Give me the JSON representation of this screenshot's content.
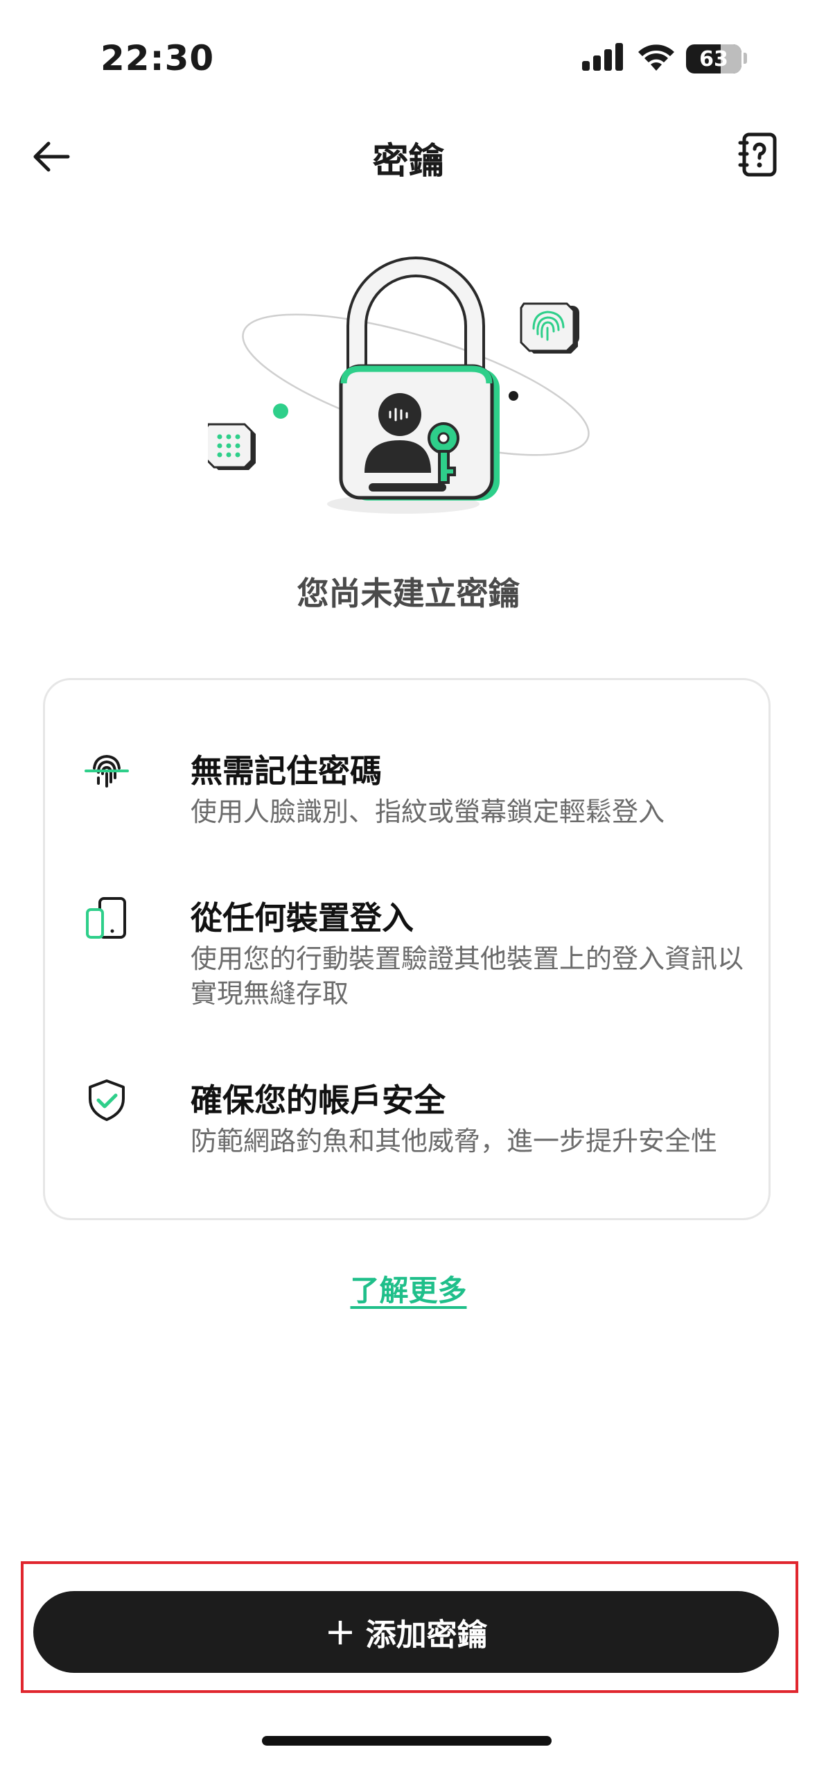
{
  "status_bar": {
    "time": "22:30",
    "battery": "63",
    "icons": [
      "signal-icon",
      "wifi-icon",
      "battery-icon"
    ]
  },
  "nav": {
    "title": "密鑰",
    "back_icon": "arrow-left-icon",
    "help_icon": "help-book-icon"
  },
  "hero": {
    "illustration": "padlock-with-user-and-key",
    "accent_color": "#2ecf8a"
  },
  "empty_state": {
    "title": "您尚未建立密鑰"
  },
  "features": [
    {
      "icon": "fingerprint-icon",
      "title": "無需記住密碼",
      "description": "使用人臉識別、指紋或螢幕鎖定輕鬆登入"
    },
    {
      "icon": "devices-icon",
      "title": "從任何裝置登入",
      "description": "使用您的行動裝置驗證其他裝置上的登入資訊以實現無縫存取"
    },
    {
      "icon": "shield-check-icon",
      "title": "確保您的帳戶安全",
      "description": "防範網路釣魚和其他威脅，進一步提升安全性"
    }
  ],
  "learn_more": {
    "label": "了解更多",
    "color": "#1fbf8a"
  },
  "primary_action": {
    "icon": "+",
    "label": "添加密鑰",
    "background": "#1c1c1c",
    "highlight_color": "#e0262e"
  }
}
